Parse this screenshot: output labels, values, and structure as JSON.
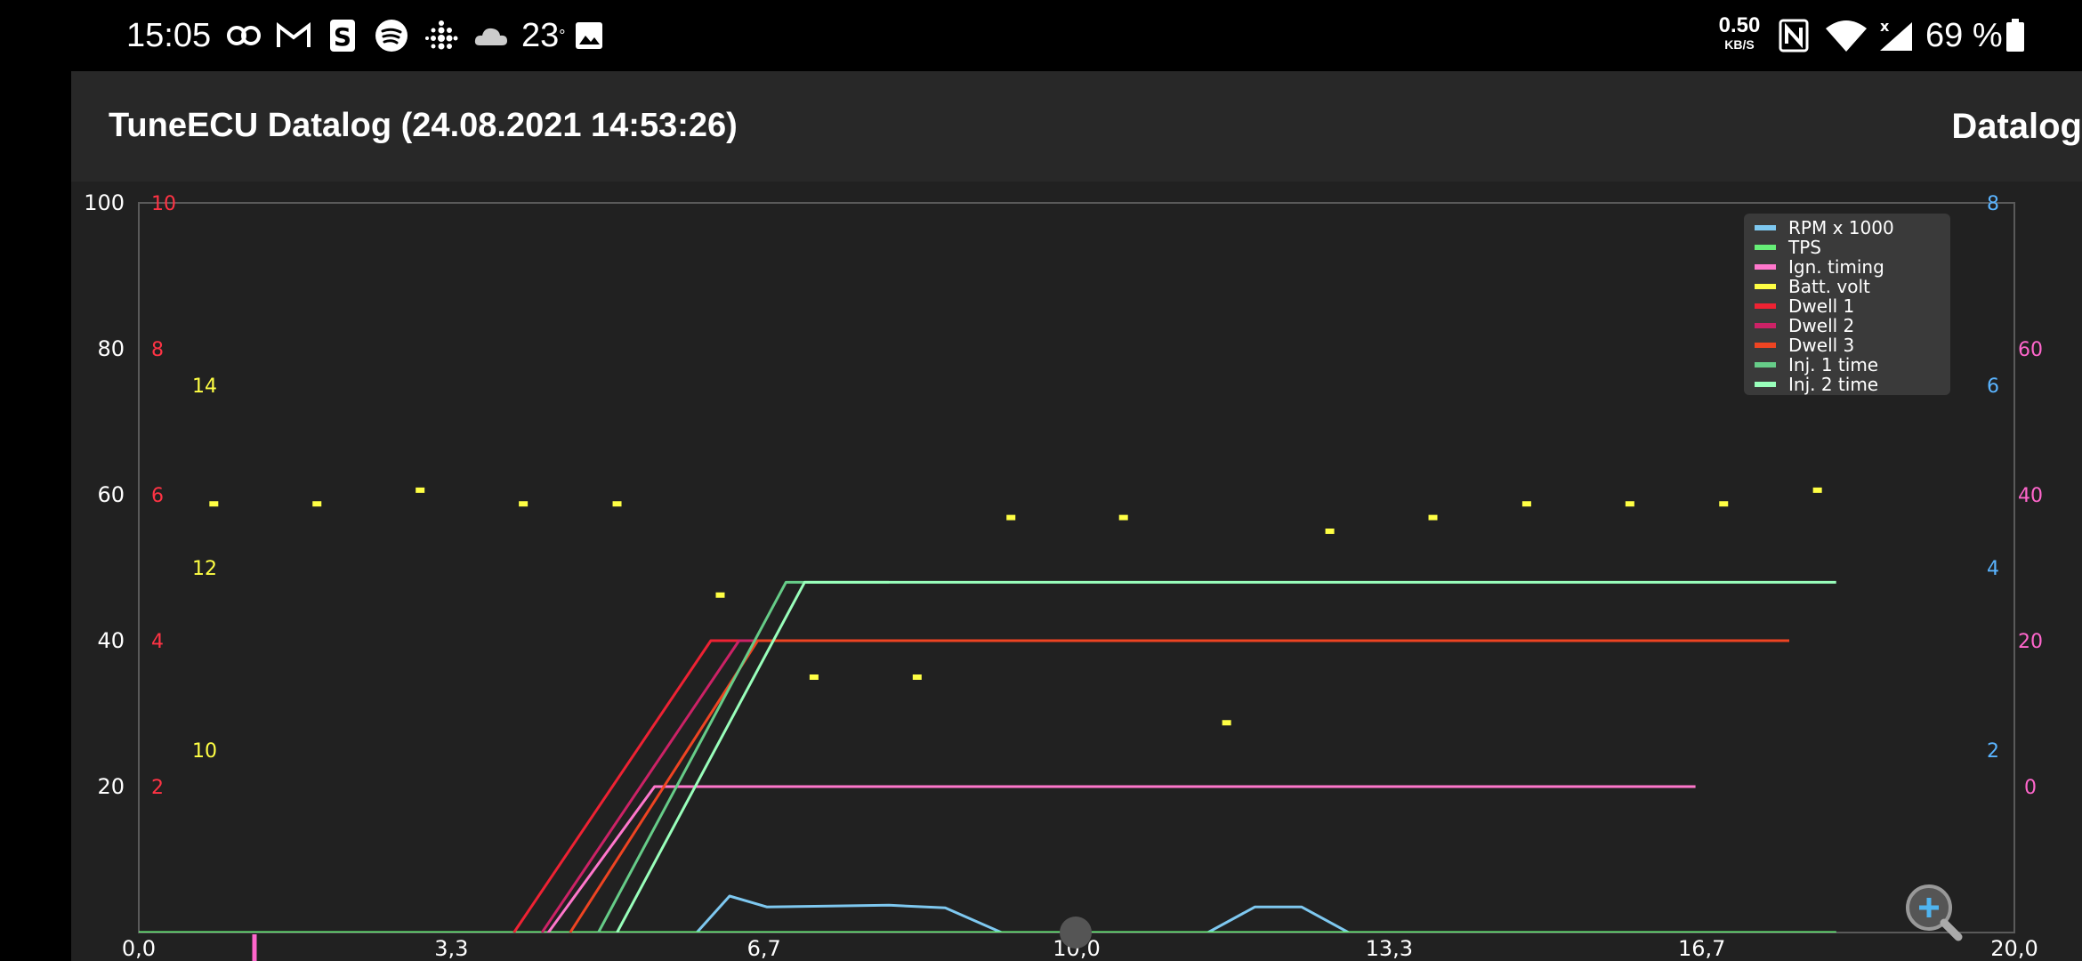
{
  "status_bar": {
    "time": "15:05",
    "temperature": "23",
    "temperature_unit": "°",
    "net_speed_value": "0.50",
    "net_speed_unit": "KB/S",
    "battery_percent": "69 %",
    "icons": [
      "link-icon",
      "gmail-icon",
      "s-app-icon",
      "spotify-icon",
      "fitbit-icon",
      "cloud-icon",
      "image-icon",
      "nfc-icon",
      "wifi-icon",
      "no-signal-icon",
      "battery-icon"
    ]
  },
  "header": {
    "title": "TuneECU Datalog (24.08.2021 14:53:26)",
    "screen_label": "Datalog"
  },
  "chart_data": {
    "type": "line",
    "title": "",
    "x_range": [
      0,
      20
    ],
    "x_ticks": [
      "0,0",
      "3,3",
      "6,7",
      "10,0",
      "13,3",
      "16,7",
      "20,0"
    ],
    "left_axis_tps": {
      "ticks": [
        "100",
        "80",
        "60",
        "40",
        "20"
      ],
      "range": [
        0,
        100
      ]
    },
    "left_axis_dwell": {
      "ticks": [
        "10",
        "8",
        "6",
        "4",
        "2"
      ],
      "range": [
        0,
        10
      ],
      "color": "#ff3344"
    },
    "left_axis_batt": {
      "ticks": [
        "14",
        "12",
        "10"
      ],
      "range": [
        8,
        16
      ],
      "color": "#ffff44"
    },
    "right_axis_rpm": {
      "ticks": [
        "8",
        "6",
        "4",
        "2"
      ],
      "range": [
        0,
        8
      ],
      "color": "#5ab4ff"
    },
    "right_axis_ign": {
      "ticks": [
        "60",
        "40",
        "20",
        "0"
      ],
      "range": [
        -20,
        80
      ],
      "color": "#ff66cc"
    },
    "series": [
      {
        "name": "RPM x 1000",
        "color": "#7ec8f0",
        "axis": "rpm",
        "x": [
          0,
          5.95,
          6.3,
          6.7,
          8.0,
          8.6,
          9.2,
          11.4,
          11.9,
          12.4,
          12.9,
          18.1
        ],
        "y": [
          0,
          0,
          0.4,
          0.28,
          0.3,
          0.27,
          0,
          0,
          0.28,
          0.28,
          0,
          0
        ]
      },
      {
        "name": "TPS",
        "color": "#66ee77",
        "axis": "tps",
        "x": [
          0,
          18.1
        ],
        "y": [
          0,
          0
        ]
      },
      {
        "name": "Ign. timing",
        "color": "#ff77cc",
        "axis": "ign",
        "x": [
          3.8,
          5.5,
          16.6
        ],
        "y": [
          -30,
          0,
          0
        ]
      },
      {
        "name": "Batt. volt",
        "color": "#ffff44",
        "axis": "batt",
        "style": "dots",
        "x": [
          0.8,
          1.9,
          3.0,
          4.1,
          5.1,
          6.2,
          7.2,
          8.3,
          9.3,
          10.5,
          11.6,
          12.7,
          13.8,
          14.8,
          15.9,
          16.9,
          17.9
        ],
        "y": [
          12.7,
          12.7,
          12.85,
          12.7,
          12.7,
          11.7,
          10.8,
          10.8,
          12.55,
          12.55,
          10.3,
          12.4,
          12.55,
          12.7,
          12.7,
          12.7,
          12.85
        ]
      },
      {
        "name": "Dwell 1",
        "color": "#ee2233",
        "axis": "dwell",
        "x": [
          4.0,
          6.1,
          8.0
        ],
        "y": [
          0,
          4,
          4
        ]
      },
      {
        "name": "Dwell 2",
        "color": "#cc2266",
        "axis": "dwell",
        "x": [
          4.3,
          6.4,
          8.0
        ],
        "y": [
          0,
          4,
          4
        ]
      },
      {
        "name": "Dwell 3",
        "color": "#ee4422",
        "axis": "dwell",
        "x": [
          4.6,
          6.6,
          17.6
        ],
        "y": [
          0,
          4,
          4
        ]
      },
      {
        "name": "Inj. 1 time",
        "color": "#66cc88",
        "axis": "tps",
        "x": [
          4.9,
          6.9,
          8.0
        ],
        "y": [
          0,
          48,
          48
        ]
      },
      {
        "name": "Inj. 2 time",
        "color": "#99ffbb",
        "axis": "tps",
        "x": [
          5.1,
          7.1,
          18.1
        ],
        "y": [
          0,
          48,
          48
        ]
      }
    ],
    "legend_position": "top-right",
    "grid": false
  }
}
